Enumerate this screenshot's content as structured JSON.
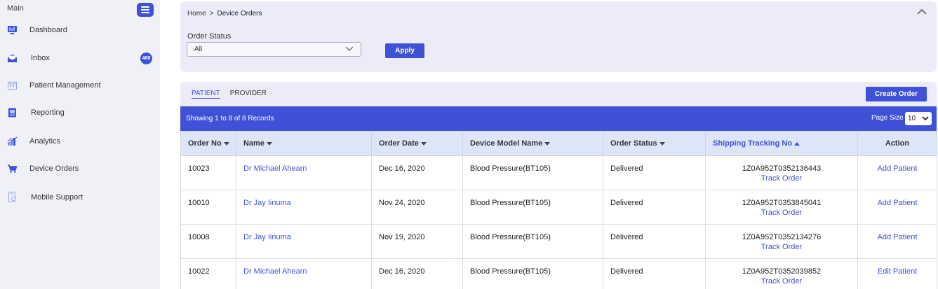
{
  "sidebar": {
    "title": "Main",
    "items": [
      {
        "label": "Dashboard",
        "icon": "dashboard-icon",
        "badge": ""
      },
      {
        "label": "Inbox",
        "icon": "inbox-icon",
        "badge": "488"
      },
      {
        "label": "Patient Management",
        "icon": "calendar-icon",
        "badge": ""
      },
      {
        "label": "Reporting",
        "icon": "report-icon",
        "badge": ""
      },
      {
        "label": "Analytics",
        "icon": "bar-chart-icon",
        "badge": ""
      },
      {
        "label": "Device Orders",
        "icon": "cart-icon",
        "badge": ""
      },
      {
        "label": "Mobile Support",
        "icon": "mobile-icon",
        "badge": ""
      }
    ]
  },
  "breadcrumb": {
    "home": "Home",
    "separator": ">",
    "current": "Device Orders"
  },
  "filter": {
    "status_label": "Order Status",
    "status_value": "All",
    "apply_label": "Apply"
  },
  "tabs": [
    {
      "label": "PATIENT",
      "active": true
    },
    {
      "label": "PROVIDER",
      "active": false
    }
  ],
  "create_button": "Create Order",
  "records": {
    "text": "Showing 1 to 8 of 8 Records",
    "page_size_label": "Page Size",
    "page_size": "10"
  },
  "table": {
    "columns": [
      "Order No",
      "Name",
      "Order Date",
      "Device Model Name",
      "Order Status",
      "Shipping Tracking No",
      "Action"
    ],
    "rows": [
      {
        "order_no": "10023",
        "name": "Dr Michael Ahearn",
        "date": "Dec 16, 2020",
        "model": "Blood Pressure(BT105)",
        "status": "Delivered",
        "tracking": "1Z0A952T0352136443",
        "track_label": "Track Order",
        "action": "Add Patient"
      },
      {
        "order_no": "10010",
        "name": "Dr Jay Iinuma",
        "date": "Nov 24, 2020",
        "model": "Blood Pressure(BT105)",
        "status": "Delivered",
        "tracking": "1Z0A952T0353845041",
        "track_label": "Track Order",
        "action": "Add Patient"
      },
      {
        "order_no": "10008",
        "name": "Dr Jay Iinuma",
        "date": "Nov 19, 2020",
        "model": "Blood Pressure(BT105)",
        "status": "Delivered",
        "tracking": "1Z0A952T0352134276",
        "track_label": "Track Order",
        "action": "Add Patient"
      },
      {
        "order_no": "10022",
        "name": "Dr Michael Ahearn",
        "date": "Dec 16, 2020",
        "model": "Blood Pressure(BT105)",
        "status": "Delivered",
        "tracking": "1Z0A952T0352039852",
        "track_label": "Track Order",
        "action": "Edit Patient"
      }
    ]
  },
  "colors": {
    "accent": "#3f51d6",
    "sidebar_bg": "#f0f1f7",
    "panel_bg": "#ebecf7",
    "header_bg": "#dce6f8"
  }
}
